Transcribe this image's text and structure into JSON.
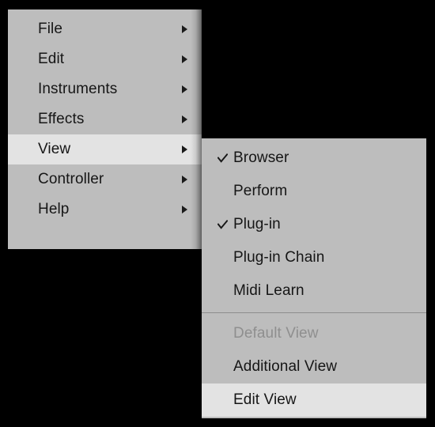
{
  "theme": {
    "menu_background": "#BDBDBD",
    "highlight_background": "#E3E3E3",
    "text_color": "#161616",
    "disabled_text_color": "#8F8F8F",
    "separator_color": "#8E8E8E",
    "backdrop_color": "#000000"
  },
  "root_menu": {
    "name": "main-menu",
    "items": [
      {
        "label": "File",
        "has_submenu": true,
        "highlighted": false
      },
      {
        "label": "Edit",
        "has_submenu": true,
        "highlighted": false
      },
      {
        "label": "Instruments",
        "has_submenu": true,
        "highlighted": false
      },
      {
        "label": "Effects",
        "has_submenu": true,
        "highlighted": false
      },
      {
        "label": "View",
        "has_submenu": true,
        "highlighted": true
      },
      {
        "label": "Controller",
        "has_submenu": true,
        "highlighted": false
      },
      {
        "label": "Help",
        "has_submenu": true,
        "highlighted": false
      }
    ],
    "submenu_arrow_icon": "triangle-right-icon"
  },
  "view_submenu": {
    "name": "view-submenu",
    "parent": "View",
    "check_icon": "check-icon",
    "groups": [
      {
        "items": [
          {
            "label": "Browser",
            "checked": true,
            "disabled": false,
            "highlighted": false
          },
          {
            "label": "Perform",
            "checked": false,
            "disabled": false,
            "highlighted": false
          },
          {
            "label": "Plug-in",
            "checked": true,
            "disabled": false,
            "highlighted": false
          },
          {
            "label": "Plug-in Chain",
            "checked": false,
            "disabled": false,
            "highlighted": false
          },
          {
            "label": "Midi Learn",
            "checked": false,
            "disabled": false,
            "highlighted": false
          }
        ]
      },
      {
        "items": [
          {
            "label": "Default View",
            "checked": false,
            "disabled": true,
            "highlighted": false
          },
          {
            "label": "Additional View",
            "checked": false,
            "disabled": false,
            "highlighted": false
          },
          {
            "label": "Edit View",
            "checked": false,
            "disabled": false,
            "highlighted": true
          }
        ]
      }
    ]
  }
}
